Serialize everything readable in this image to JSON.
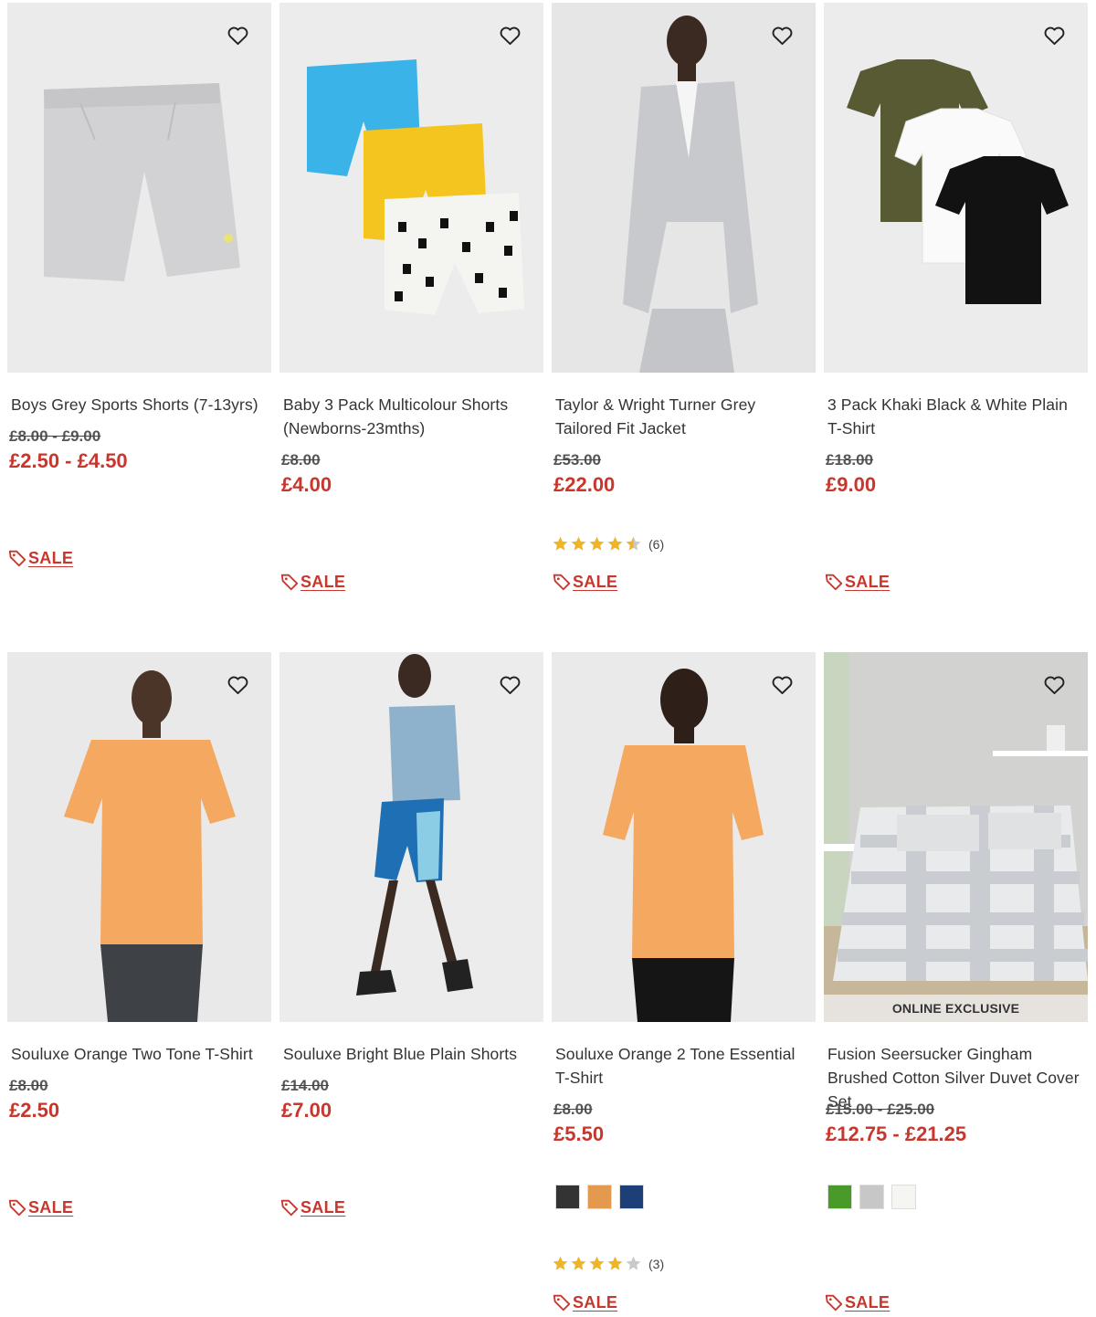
{
  "colors": {
    "price_red": "#c8372d",
    "text": "#333333",
    "star": "#f0b429"
  },
  "products": [
    {
      "name": "Boys Grey Sports Shorts (7-13yrs)",
      "was": "£8.00 - £9.00",
      "now": "£2.50 - £4.50",
      "sale_label": "SALE",
      "wishlist_icon": "heart-outline-icon"
    },
    {
      "name": "Baby 3 Pack Multicolour Shorts (Newborns-23mths)",
      "was": "£8.00",
      "now": "£4.00",
      "sale_label": "SALE",
      "wishlist_icon": "heart-outline-icon"
    },
    {
      "name": "Taylor & Wright Turner Grey Tailored Fit Jacket",
      "was": "£53.00",
      "now": "£22.00",
      "rating": 4.5,
      "review_count": "(6)",
      "sale_label": "SALE",
      "wishlist_icon": "heart-outline-icon"
    },
    {
      "name": "3 Pack Khaki Black & White Plain T-Shirt",
      "was": "£18.00",
      "now": "£9.00",
      "sale_label": "SALE",
      "wishlist_icon": "heart-outline-icon"
    },
    {
      "name": "Souluxe Orange Two Tone T-Shirt",
      "was": "£8.00",
      "now": "£2.50",
      "sale_label": "SALE",
      "wishlist_icon": "heart-outline-icon"
    },
    {
      "name": "Souluxe Bright Blue Plain Shorts",
      "was": "£14.00",
      "now": "£7.00",
      "sale_label": "SALE",
      "wishlist_icon": "heart-outline-icon"
    },
    {
      "name": "Souluxe Orange 2 Tone Essential T-Shirt",
      "was": "£8.00",
      "now": "£5.50",
      "swatches": [
        "#333333",
        "#e39a4e",
        "#1d3f78"
      ],
      "rating": 4,
      "review_count": "(3)",
      "sale_label": "SALE",
      "wishlist_icon": "heart-outline-icon"
    },
    {
      "name": "Fusion Seersucker Gingham Brushed Cotton Silver Duvet Cover Set",
      "badge": "ONLINE EXCLUSIVE",
      "was": "£15.00 - £25.00",
      "now": "£12.75 - £21.25",
      "swatches": [
        "#4a9a2a",
        "#c7c7c7",
        "#f5f5f2"
      ],
      "sale_label": "SALE",
      "wishlist_icon": "heart-outline-icon"
    }
  ]
}
